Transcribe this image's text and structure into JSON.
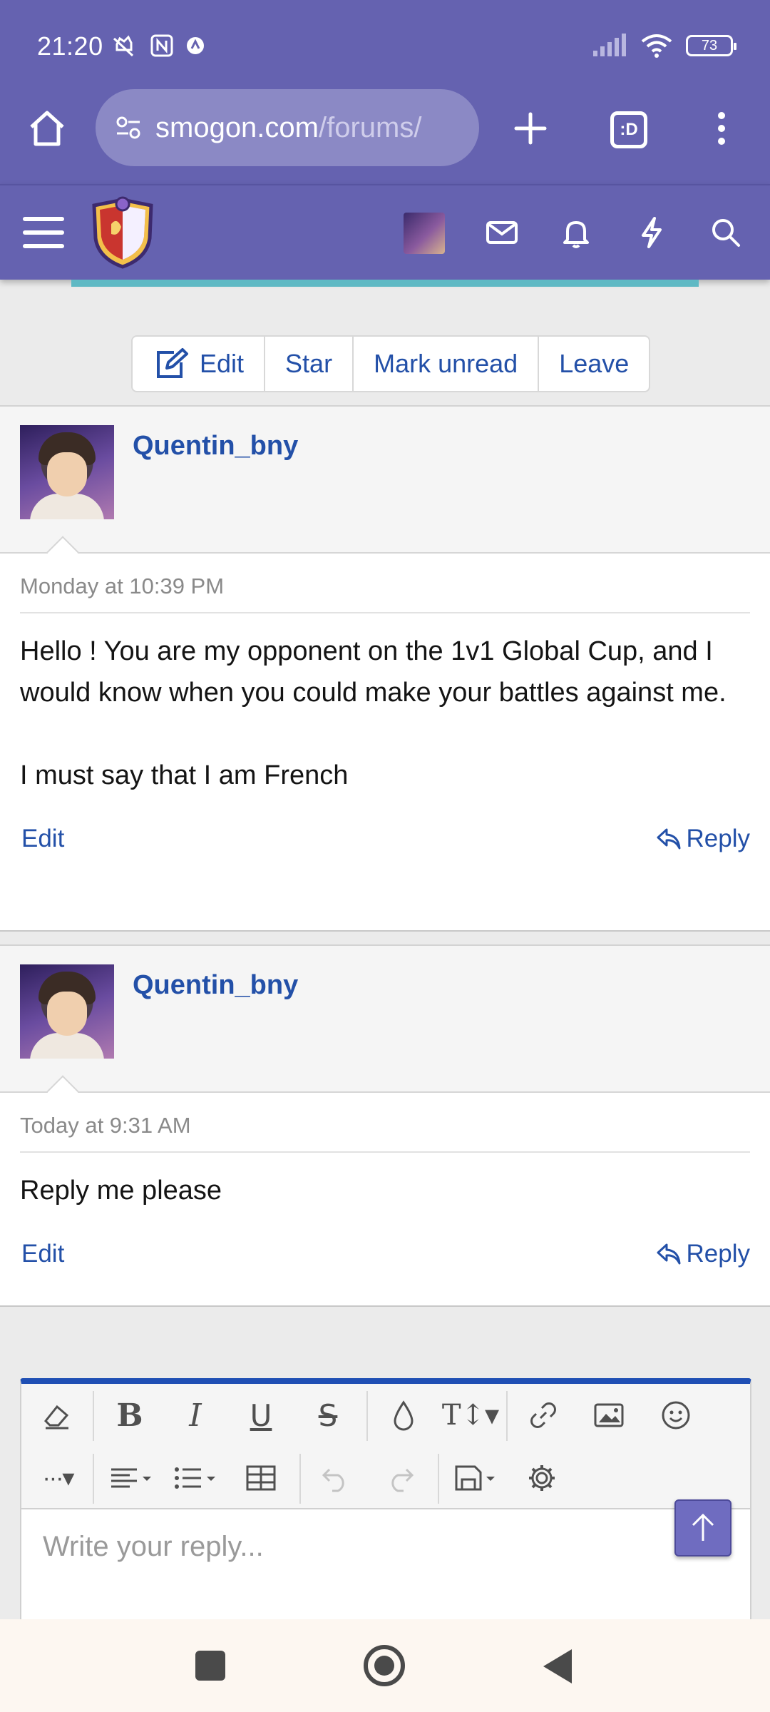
{
  "status_bar": {
    "time": "21:20",
    "battery": "73"
  },
  "browser": {
    "url_domain": "smogon.com",
    "url_path": "/forums/",
    "tabs_label": ":D"
  },
  "thread_actions": {
    "edit": "Edit",
    "star": "Star",
    "mark_unread": "Mark unread",
    "leave": "Leave"
  },
  "messages": [
    {
      "author": "Quentin_bny",
      "date": "Monday at 10:39 PM",
      "text": "Hello ! You are my opponent on the 1v1 Global Cup, and I would know when you could make your battles against me.\n\nI must say that I am French",
      "edit": "Edit",
      "reply": "Reply"
    },
    {
      "author": "Quentin_bny",
      "date": "Today at 9:31 AM",
      "text": "Reply me please",
      "edit": "Edit",
      "reply": "Reply"
    }
  ],
  "editor": {
    "placeholder": "Write your reply..."
  },
  "colors": {
    "brand": "#6562b0",
    "link": "#2350a8",
    "editor_accent": "#1f4fb4"
  }
}
